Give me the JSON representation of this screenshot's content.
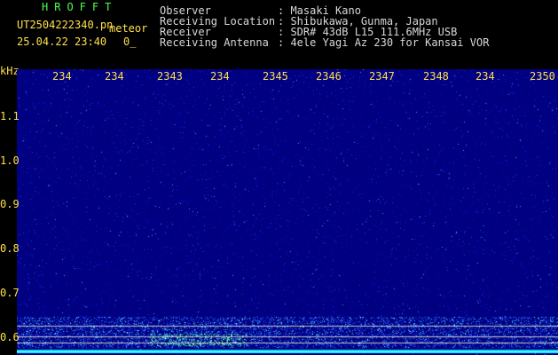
{
  "header": {
    "software": "HROFFT",
    "filename": "UT2504222340.pn",
    "detection_label": "meteor",
    "date_time": "25.04.22 23:40",
    "count": "0_",
    "info_labels": [
      "Observer",
      "Receiving Location",
      "Receiver",
      "Receiving Antenna"
    ],
    "info_values": [
      ": Masaki Kano",
      ": Shibukawa, Gunma, Japan",
      ": SDR# 43dB L15 111.6MHz USB",
      ": 4ele Yagi Az 230 for Kansai VOR"
    ]
  },
  "axis": {
    "y_unit": "kHz",
    "y_ticks": [
      "1.1",
      "1.0",
      "0.9",
      "0.8",
      "0.7",
      "0.6"
    ],
    "x_ticks": [
      "234",
      "234",
      "2343",
      "234",
      "2345",
      "2346",
      "2347",
      "2348",
      "234",
      "2350"
    ]
  },
  "colors": {
    "background": "#000080",
    "label_text": "#ffe048",
    "title_green": "#4cff4c",
    "signal_cyan": "#00e0ff",
    "marker_line": "#c8c8c8"
  },
  "chart_data": {
    "type": "heatmap",
    "y_unit": "kHz",
    "ylim": [
      0.56,
      1.16
    ],
    "y_ticks": [
      1.1,
      1.0,
      0.9,
      0.8,
      0.7,
      0.6
    ],
    "x_tick_labels": [
      "234",
      "234",
      "2343",
      "234",
      "2345",
      "2346",
      "2347",
      "2348",
      "234",
      "2350"
    ],
    "reference_lines_khz": [
      0.622,
      0.6,
      0.587
    ],
    "carrier_khz": 0.567
  }
}
